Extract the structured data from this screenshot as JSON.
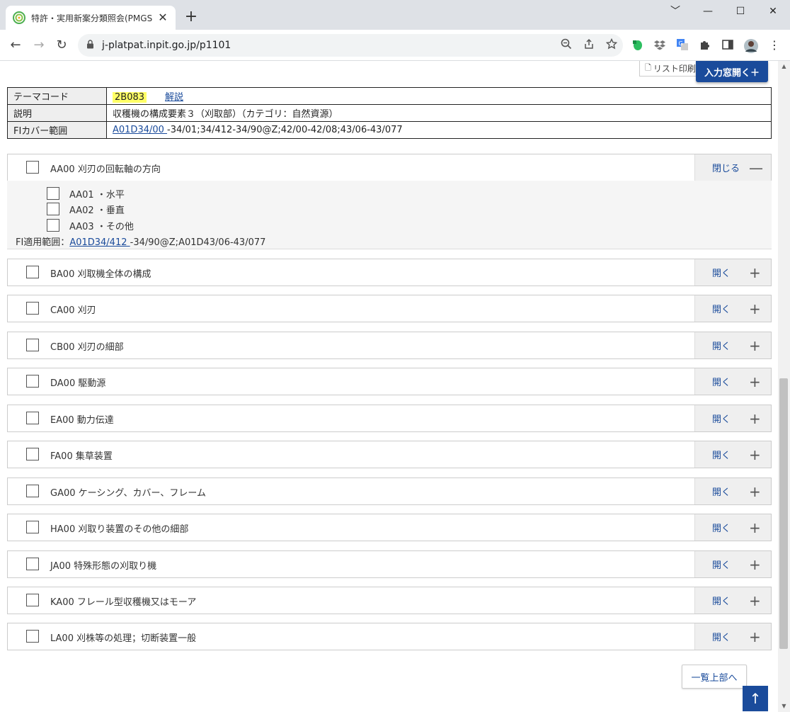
{
  "browser": {
    "tab_title": "特許・実用新案分類照会(PMGS) |",
    "tab_close": "✕",
    "new_tab": "+",
    "window": {
      "minimize": "﹀",
      "minimize2": "—",
      "maximize": "☐",
      "close": "✕"
    },
    "nav": {
      "back": "←",
      "forward": "→",
      "reload": "↻"
    },
    "url": "j-platpat.inpit.go.jp/p1101"
  },
  "page": {
    "print_label": "リスト印刷",
    "input_window_label": "入力窓開く＋",
    "info": {
      "theme_code_key": "テーマコード",
      "theme_code_value": "2B083",
      "theme_code_link": "解説",
      "description_key": "説明",
      "description_value": "収穫機の構成要素３（刈取部）（カテゴリ：自然資源）",
      "fi_cover_key": "FIカバー範囲",
      "fi_cover_link": "A01D34/00 ",
      "fi_cover_rest": "-34/01;34/412-34/90@Z;42/00-42/08;43/06-43/077"
    },
    "close_label": "閉じる",
    "open_label": "開く",
    "minus": "—",
    "plus": "+",
    "expanded_row": {
      "label": "AA00 刈刃の回転軸の方向"
    },
    "subitems": [
      {
        "label": "AA01 ・水平"
      },
      {
        "label": "AA02 ・垂直"
      },
      {
        "label": "AA03 ・その他"
      }
    ],
    "fi_apply_label": "FI適用範囲：",
    "fi_apply_link": "A01D34/412 ",
    "fi_apply_rest": "-34/90@Z;A01D43/06-43/077",
    "rows": [
      {
        "label": "BA00 刈取機全体の構成"
      },
      {
        "label": "CA00 刈刃"
      },
      {
        "label": "CB00 刈刃の細部"
      },
      {
        "label": "DA00 駆動源"
      },
      {
        "label": "EA00 動力伝達"
      },
      {
        "label": "FA00 集草装置"
      },
      {
        "label": "GA00 ケーシング、カバー、フレーム"
      },
      {
        "label": "HA00 刈取り装置のその他の細部"
      },
      {
        "label": "JA00 特殊形態の刈取り機"
      },
      {
        "label": "KA00 フレール型収穫機又はモーア"
      },
      {
        "label": "LA00 刈株等の処理；切断装置一般"
      }
    ],
    "back_to_top_label": "一覧上部へ",
    "to_top_arrow": "↑"
  }
}
